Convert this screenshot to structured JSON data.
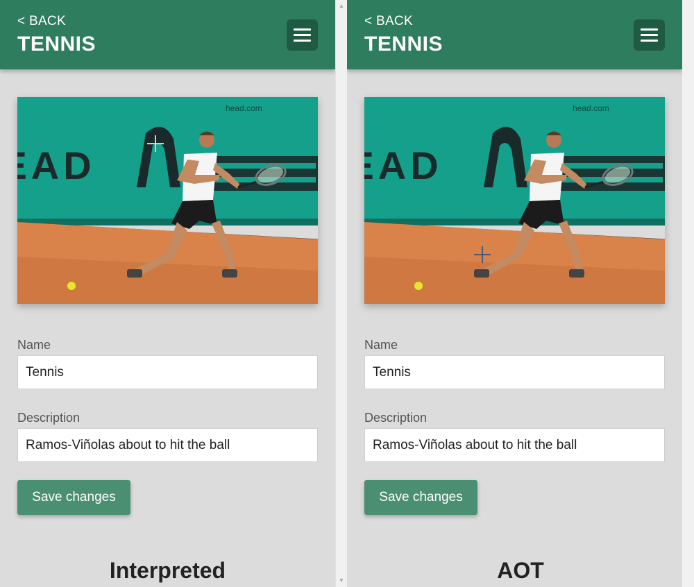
{
  "panels": [
    {
      "back_label": "< BACK",
      "title": "TENNIS",
      "name_label": "Name",
      "name_value": "Tennis",
      "description_label": "Description",
      "description_value": "Ramos-Viñolas about to hit the ball",
      "save_label": "Save changes",
      "caption": "Interpreted",
      "photo_watermark": "head.com",
      "photo_wall_text": "HEAD"
    },
    {
      "back_label": "< BACK",
      "title": "TENNIS",
      "name_label": "Name",
      "name_value": "Tennis",
      "description_label": "Description",
      "description_value": "Ramos-Viñolas about to hit the ball",
      "save_label": "Save changes",
      "caption": "AOT",
      "photo_watermark": "head.com",
      "photo_wall_text": "HEAD"
    }
  ],
  "icons": {
    "menu": "hamburger-menu-icon",
    "cursor": "crosshair-cursor-icon",
    "scroll_up": "▲",
    "scroll_down": "▼"
  },
  "colors": {
    "header": "#2e7d5e",
    "menu_button": "#1f5a43",
    "save_button": "#4b8f72",
    "background": "#dcdcdc",
    "wall": "#15a08c",
    "court": "#d9824a"
  }
}
